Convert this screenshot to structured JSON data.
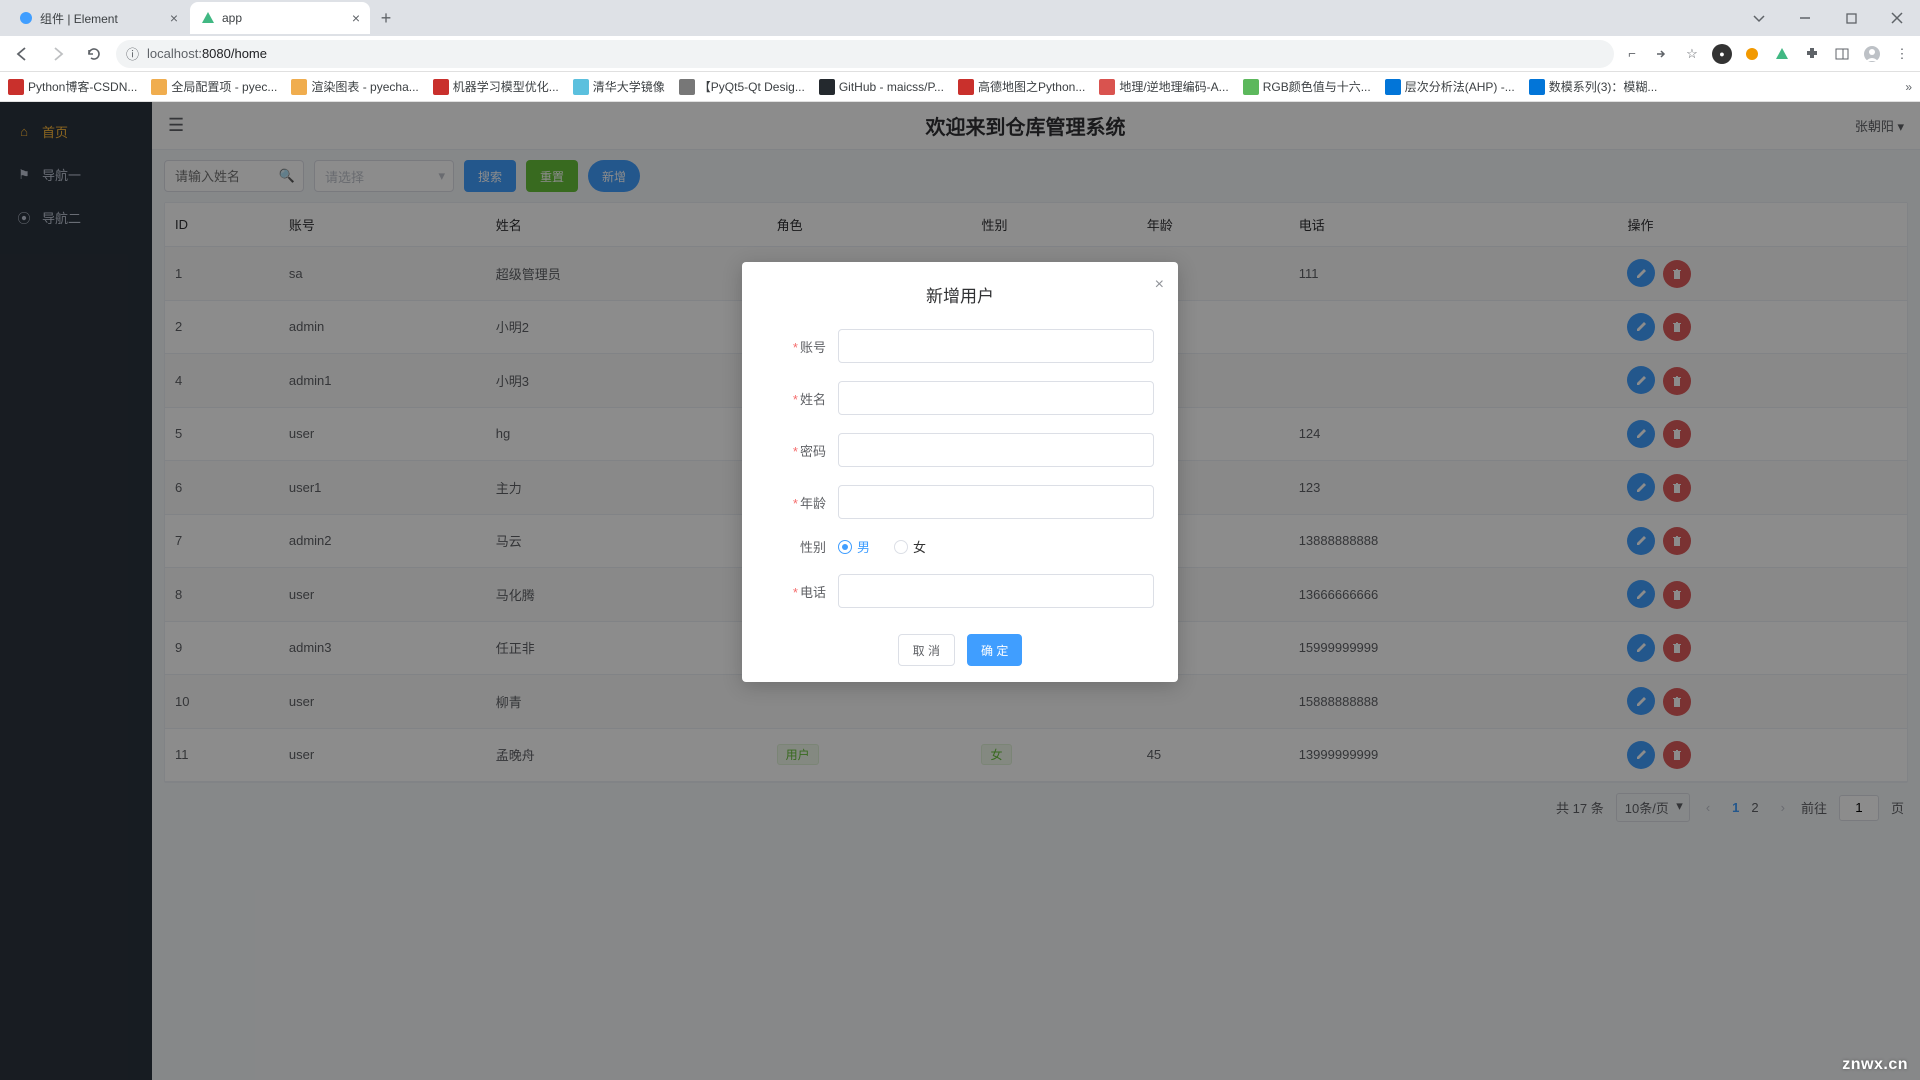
{
  "browser": {
    "tabs": [
      {
        "title": "组件 | Element",
        "favicon_color": "#409eff"
      },
      {
        "title": "app",
        "favicon_color": "#41b883"
      }
    ],
    "url_prefix": "localhost:",
    "url_suffix": "8080/home",
    "bookmarks": [
      {
        "label": "Python博客-CSDN...",
        "color": "#c9302c"
      },
      {
        "label": "全局配置项 - pyec...",
        "color": "#f0ad4e"
      },
      {
        "label": "渲染图表 - pyecha...",
        "color": "#f0ad4e"
      },
      {
        "label": "机器学习模型优化...",
        "color": "#c9302c"
      },
      {
        "label": "清华大学镜像",
        "color": "#5bc0de"
      },
      {
        "label": "【PyQt5-Qt Desig...",
        "color": "#777"
      },
      {
        "label": "GitHub - maicss/P...",
        "color": "#24292e"
      },
      {
        "label": "高德地图之Python...",
        "color": "#c9302c"
      },
      {
        "label": "地理/逆地理编码-A...",
        "color": "#d9534f"
      },
      {
        "label": "RGB颜色值与十六...",
        "color": "#5cb85c"
      },
      {
        "label": "层次分析法(AHP) -...",
        "color": "#0275d8"
      },
      {
        "label": "数模系列(3)：模糊...",
        "color": "#0275d8"
      }
    ]
  },
  "sidebar": {
    "items": [
      {
        "label": "首页",
        "icon": "home"
      },
      {
        "label": "导航一",
        "icon": "flag"
      },
      {
        "label": "导航二",
        "icon": "pin"
      }
    ]
  },
  "header": {
    "title": "欢迎来到仓库管理系统",
    "user": "张朝阳"
  },
  "toolbar": {
    "search_placeholder": "请输入姓名",
    "select_placeholder": "请选择",
    "search_label": "搜索",
    "reset_label": "重置",
    "add_label": "新增"
  },
  "table": {
    "columns": [
      "ID",
      "账号",
      "姓名",
      "角色",
      "性别",
      "年龄",
      "电话",
      "操作"
    ],
    "rows": [
      {
        "id": "1",
        "account": "sa",
        "name": "超级管理员",
        "role": "",
        "sex": "",
        "age": "",
        "phone": "111"
      },
      {
        "id": "2",
        "account": "admin",
        "name": "小明2",
        "role": "",
        "sex": "",
        "age": "",
        "phone": ""
      },
      {
        "id": "4",
        "account": "admin1",
        "name": "小明3",
        "role": "",
        "sex": "",
        "age": "",
        "phone": ""
      },
      {
        "id": "5",
        "account": "user",
        "name": "hg",
        "role": "",
        "sex": "",
        "age": "",
        "phone": "124"
      },
      {
        "id": "6",
        "account": "user1",
        "name": "主力",
        "role": "",
        "sex": "",
        "age": "",
        "phone": "123"
      },
      {
        "id": "7",
        "account": "admin2",
        "name": "马云",
        "role": "",
        "sex": "",
        "age": "",
        "phone": "13888888888"
      },
      {
        "id": "8",
        "account": "user",
        "name": "马化腾",
        "role": "",
        "sex": "",
        "age": "",
        "phone": "13666666666"
      },
      {
        "id": "9",
        "account": "admin3",
        "name": "任正非",
        "role": "",
        "sex": "",
        "age": "",
        "phone": "15999999999"
      },
      {
        "id": "10",
        "account": "user",
        "name": "柳青",
        "role": "",
        "sex": "",
        "age": "",
        "phone": "15888888888"
      },
      {
        "id": "11",
        "account": "user",
        "name": "孟晚舟",
        "role": "用户",
        "sex": "女",
        "age": "45",
        "phone": "13999999999"
      }
    ]
  },
  "pager": {
    "total_text": "共 17 条",
    "size_text": "10条/页",
    "pages": [
      "1",
      "2"
    ],
    "active_page": "1",
    "goto_prefix": "前往",
    "goto_value": "1",
    "goto_suffix": "页"
  },
  "dialog": {
    "title": "新增用户",
    "fields": {
      "account": "账号",
      "name": "姓名",
      "password": "密码",
      "age": "年龄",
      "sex": "性别",
      "phone": "电话"
    },
    "sex_options": {
      "male": "男",
      "female": "女"
    },
    "cancel_label": "取 消",
    "ok_label": "确 定"
  },
  "watermark": "znwx.cn"
}
